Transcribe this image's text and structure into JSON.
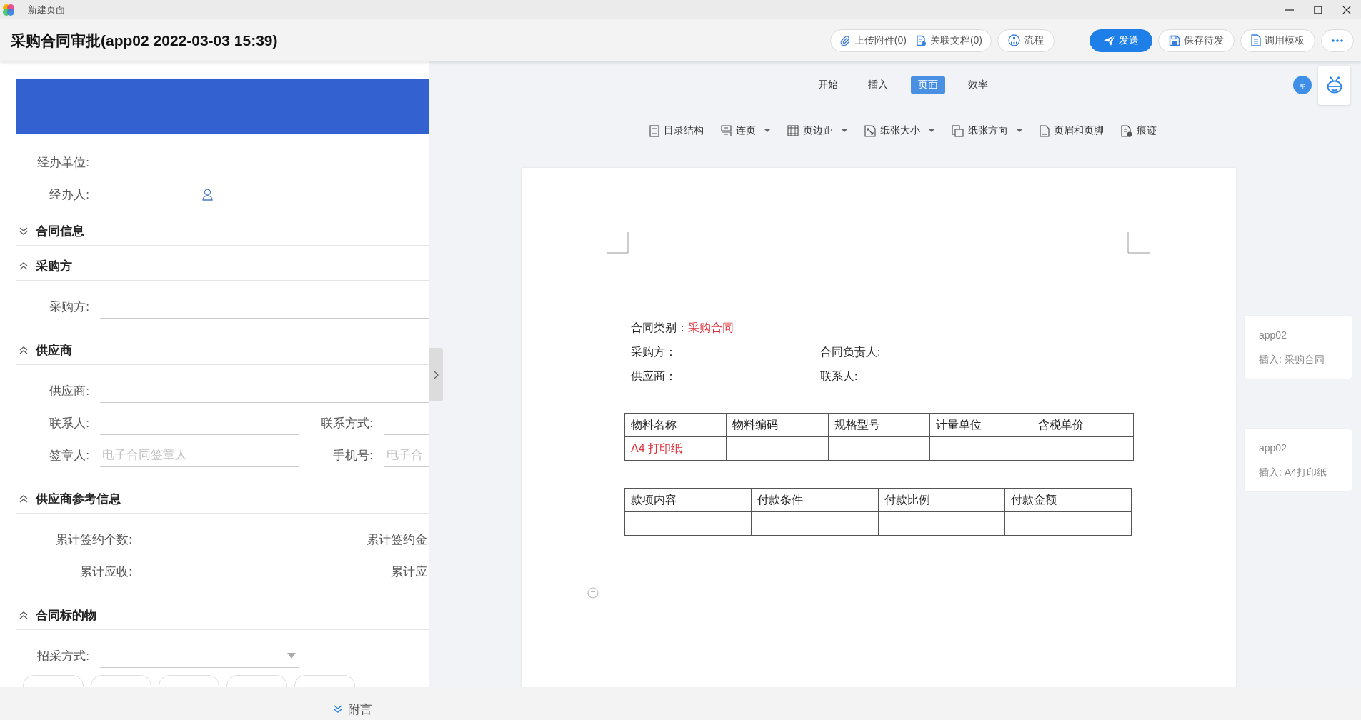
{
  "window": {
    "title": "新建页面"
  },
  "header": {
    "title": "采购合同审批(app02 2022-03-03 15:39)",
    "action_groups": [
      {
        "actions": [
          {
            "label": "上传附件(0)",
            "kind": "attach",
            "primary": false
          },
          {
            "label": "关联文档(0)",
            "kind": "link",
            "primary": false
          }
        ]
      },
      {
        "actions": [
          {
            "label": "流程",
            "kind": "flow",
            "primary": false
          }
        ]
      },
      {
        "actions": [
          {
            "label": "发送",
            "kind": "send",
            "primary": true
          }
        ]
      },
      {
        "actions": [
          {
            "label": "保存待发",
            "kind": "save",
            "primary": false
          }
        ]
      },
      {
        "actions": [
          {
            "label": "调用模板",
            "kind": "template",
            "primary": false
          }
        ]
      },
      {
        "actions": [
          {
            "kind": "more",
            "primary": false
          }
        ]
      }
    ]
  },
  "form": {
    "top_fields": [
      {
        "label": "经办单位:",
        "kind": "value"
      },
      {
        "label": "经办人:",
        "kind": "person"
      }
    ],
    "sections": [
      {
        "title": "合同信息",
        "expanded": false
      },
      {
        "title": "采购方",
        "expanded": true,
        "rows": [
          [
            {
              "label": "采购方:",
              "kind": "input"
            }
          ]
        ]
      },
      {
        "title": "供应商",
        "expanded": true,
        "rows": [
          [
            {
              "label": "供应商:",
              "kind": "input"
            }
          ],
          [
            {
              "label": "联系人:",
              "kind": "input"
            },
            {
              "label": "联系方式:",
              "kind": "input"
            }
          ],
          [
            {
              "label": "签章人:",
              "kind": "input",
              "placeholder": "电子合同签章人"
            },
            {
              "label": "手机号:",
              "kind": "input",
              "placeholder": "电子合"
            }
          ]
        ]
      },
      {
        "title": "供应商参考信息",
        "expanded": true,
        "rows": [
          [
            {
              "label": "累计签约个数:",
              "kind": "value"
            },
            {
              "label": "累计签约金",
              "kind": "value"
            }
          ],
          [
            {
              "label": "累计应收:",
              "kind": "value"
            },
            {
              "label": "累计应",
              "kind": "value"
            }
          ]
        ]
      },
      {
        "title": "合同标的物",
        "expanded": true,
        "rows": [
          [
            {
              "label": "招采方式:",
              "kind": "select"
            }
          ]
        ],
        "chips": [
          {
            "kind": "option"
          },
          {
            "kind": "option"
          },
          {
            "kind": "option"
          },
          {
            "kind": "option"
          },
          {
            "kind": "option"
          }
        ]
      }
    ]
  },
  "ribbon": {
    "tabs": [
      {
        "label": "开始",
        "selected": false
      },
      {
        "label": "插入",
        "selected": false
      },
      {
        "label": "页面",
        "selected": true
      },
      {
        "label": "效率",
        "selected": false
      }
    ],
    "avatar": "ap",
    "tools": [
      {
        "label": "目录结构",
        "kind": "outline",
        "dropdown": false
      },
      {
        "label": "连页",
        "kind": "continuous",
        "dropdown": true
      },
      {
        "label": "页边距",
        "kind": "margins",
        "dropdown": true
      },
      {
        "label": "纸张大小",
        "kind": "size",
        "dropdown": true
      },
      {
        "label": "纸张方向",
        "kind": "orientation",
        "dropdown": true
      },
      {
        "label": "页眉和页脚",
        "kind": "headerfooter",
        "dropdown": false
      },
      {
        "label": "痕迹",
        "kind": "revisions",
        "dropdown": false
      }
    ]
  },
  "document": {
    "lines": [
      [
        {
          "label": "合同类别：",
          "value": "采购合同",
          "tracked": true
        }
      ],
      [
        {
          "label": "采购方：",
          "tracked": false
        },
        {
          "label": "合同负责人:",
          "tracked": false
        }
      ],
      [
        {
          "label": "供应商：",
          "tracked": false
        },
        {
          "label": "联系人:",
          "tracked": false
        }
      ]
    ],
    "tables": [
      {
        "columns": [
          "物料名称",
          "物料编码",
          "规格型号",
          "计量单位",
          "含税单价"
        ],
        "rows": [
          {
            "cells": [
              "A4 打印纸"
            ],
            "tracked": true
          }
        ]
      },
      {
        "columns": [
          "款项内容",
          "付款条件",
          "付款比例",
          "付款金额"
        ],
        "rows": [
          {
            "tracked": false
          }
        ]
      }
    ]
  },
  "comments": [
    {
      "author": "app02",
      "text": "插入: 采购合同"
    },
    {
      "author": "app02",
      "text": "插入: A4打印纸"
    }
  ],
  "footer": {
    "label": "附言"
  }
}
